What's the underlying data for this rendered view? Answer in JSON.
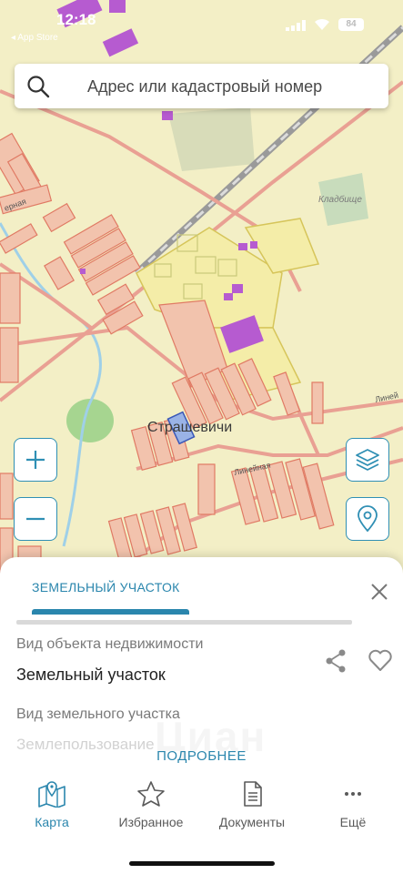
{
  "status_bar": {
    "time": "12:18",
    "back_app": "◂ App Store",
    "battery": "84"
  },
  "search": {
    "placeholder": "Адрес или кадастровый номер"
  },
  "map": {
    "labels": {
      "cemetery": "Кладбище",
      "village": "Страшевичи",
      "street_1": "Линейная",
      "street_2": "Линей",
      "street_3": "ерная"
    },
    "controls": {
      "zoom_in": "+",
      "zoom_out": "−"
    },
    "colors": {
      "background": "#f3efc6",
      "parcel_fill": "#f2c3ad",
      "parcel_stroke": "#e07a64",
      "building": "#b65bd0",
      "road": "#e9a093",
      "water": "#9fd0e8",
      "accent": "#2a86ad"
    }
  },
  "sheet": {
    "tab_label": "ЗЕМЕЛЬНЫЙ УЧАСТОК",
    "object_type_label": "Вид объекта недвижимости",
    "object_type_value": "Земельный участок",
    "parcel_type_label": "Вид земельного участка",
    "parcel_type_value": "Землепользование",
    "more_button": "ПОДРОБНЕЕ",
    "watermark": "Циан"
  },
  "nav": {
    "items": [
      {
        "label": "Карта",
        "icon": "map-icon",
        "active": true
      },
      {
        "label": "Избранное",
        "icon": "star-icon",
        "active": false
      },
      {
        "label": "Документы",
        "icon": "document-icon",
        "active": false
      },
      {
        "label": "Ещё",
        "icon": "more-dots-icon",
        "active": false
      }
    ]
  }
}
